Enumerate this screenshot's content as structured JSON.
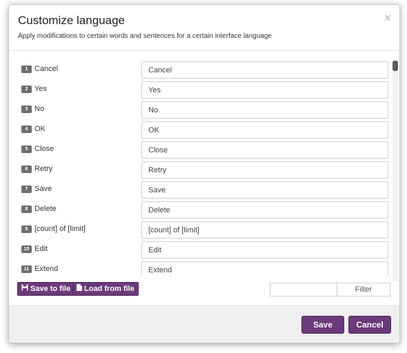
{
  "dialog": {
    "title": "Customize language",
    "subtitle": "Apply modifications to certain words and sentences for a certain interface language",
    "close_icon": "×"
  },
  "rows": [
    {
      "num": "1",
      "label": "Cancel",
      "value": "Cancel"
    },
    {
      "num": "2",
      "label": "Yes",
      "value": "Yes"
    },
    {
      "num": "3",
      "label": "No",
      "value": "No"
    },
    {
      "num": "4",
      "label": "OK",
      "value": "OK"
    },
    {
      "num": "5",
      "label": "Close",
      "value": "Close"
    },
    {
      "num": "6",
      "label": "Retry",
      "value": "Retry"
    },
    {
      "num": "7",
      "label": "Save",
      "value": "Save"
    },
    {
      "num": "8",
      "label": "Delete",
      "value": "Delete"
    },
    {
      "num": "9",
      "label": "[count] of [limit]",
      "value": "[count] of [limit]"
    },
    {
      "num": "10",
      "label": "Edit",
      "value": "Edit"
    },
    {
      "num": "11",
      "label": "Extend",
      "value": "Extend"
    }
  ],
  "toolbar": {
    "save_to_file": "Save to file",
    "load_from_file": "Load from file",
    "filter_value": "",
    "filter_label": "Filter"
  },
  "footer": {
    "save_label": "Save",
    "cancel_label": "Cancel"
  },
  "colors": {
    "accent": "#6b3a7a",
    "badge": "#6e6e6e",
    "footer_bg": "#efefef"
  }
}
